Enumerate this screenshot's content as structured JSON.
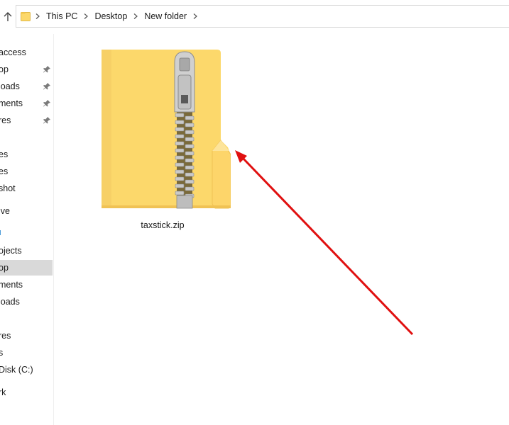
{
  "address_bar": {
    "breadcrumbs": [
      "This PC",
      "Desktop",
      "New folder"
    ]
  },
  "nav_pane": {
    "items": [
      {
        "label": "access",
        "pinned": false
      },
      {
        "label": "op",
        "pinned": true
      },
      {
        "label": "loads",
        "pinned": true
      },
      {
        "label": "ments",
        "pinned": true
      },
      {
        "label": "res",
        "pinned": true
      },
      {
        "label": "es",
        "pinned": false
      },
      {
        "label": "es",
        "pinned": false
      },
      {
        "label": "shot",
        "pinned": false
      },
      {
        "label": "ive",
        "pinned": false
      },
      {
        "label": "",
        "pinned": false
      },
      {
        "label": "ojects",
        "pinned": false
      },
      {
        "label": "op",
        "pinned": false,
        "selected": true
      },
      {
        "label": "ments",
        "pinned": false
      },
      {
        "label": "loads",
        "pinned": false
      },
      {
        "label": "",
        "pinned": false
      },
      {
        "label": "res",
        "pinned": false
      },
      {
        "label": "s",
        "pinned": false
      },
      {
        "label": " Disk (C:)",
        "pinned": false
      },
      {
        "label": "rk",
        "pinned": false
      }
    ]
  },
  "files": [
    {
      "name": "taxstick.zip",
      "icon": "zip-folder-icon"
    }
  ],
  "colors": {
    "folder_yellow": "#fcd86b",
    "selection_gray": "#d9d9d9",
    "arrow_red": "#e01010"
  }
}
